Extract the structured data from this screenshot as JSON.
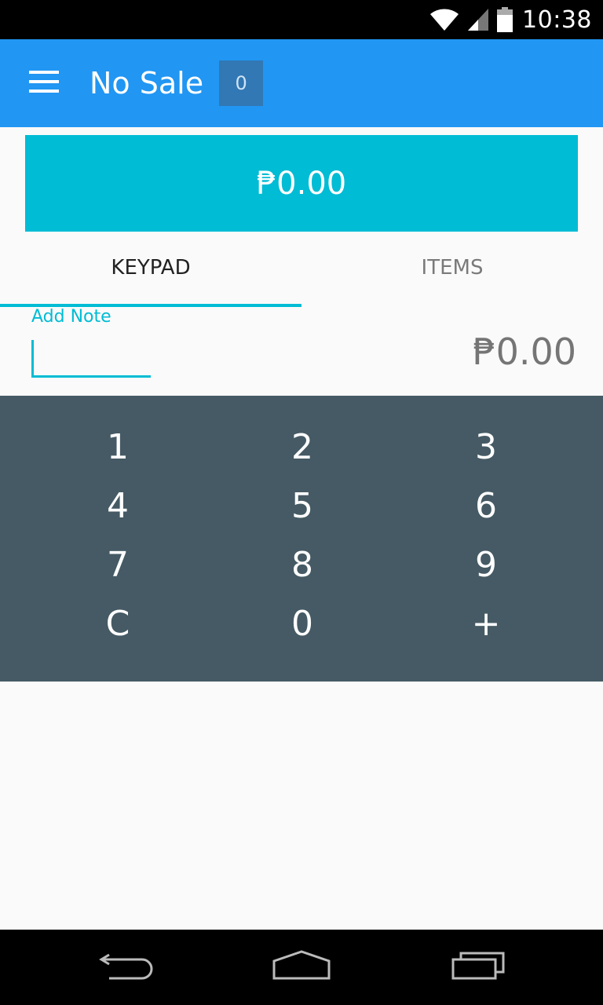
{
  "status_bar": {
    "time": "10:38",
    "icons": [
      "wifi-icon",
      "cell-signal-icon",
      "battery-icon"
    ]
  },
  "app_bar": {
    "menu_icon": "hamburger-menu-icon",
    "title": "No Sale",
    "count": "0"
  },
  "total": {
    "amount": "₱0.00"
  },
  "tabs": [
    {
      "label": "KEYPAD",
      "active": true
    },
    {
      "label": "ITEMS",
      "active": false
    }
  ],
  "note": {
    "label": "Add Note",
    "value": ""
  },
  "amount_display": "₱0.00",
  "keypad": {
    "rows": [
      [
        "1",
        "2",
        "3"
      ],
      [
        "4",
        "5",
        "6"
      ],
      [
        "7",
        "8",
        "9"
      ],
      [
        "C",
        "0",
        "+"
      ]
    ]
  },
  "nav_bar": {
    "icons": [
      "back-icon",
      "home-icon",
      "recent-apps-icon"
    ]
  },
  "colors": {
    "app_bar": "#2196f3",
    "accent": "#00bcd4",
    "keypad_bg": "#455a64",
    "badge_bg": "#3178b4"
  }
}
